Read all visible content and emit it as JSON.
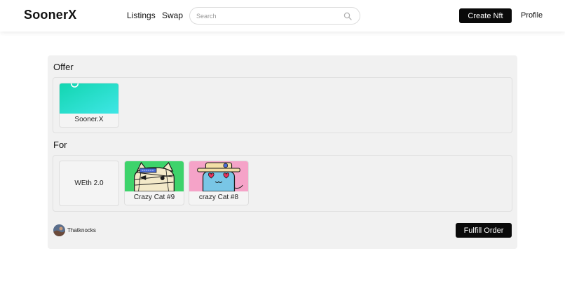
{
  "header": {
    "brand": "SoonerX",
    "nav": {
      "listings": "Listings",
      "swap": "Swap"
    },
    "search": {
      "placeholder": "Search",
      "value": ""
    },
    "create_label": "Create Nft",
    "profile_label": "Profile"
  },
  "order": {
    "offer_title": "Offer",
    "offer_items": [
      {
        "label": "Sooner.X",
        "image": "gradient-teal-cover"
      }
    ],
    "for_title": "For",
    "for_token": "WEth 2.0",
    "for_items": [
      {
        "label": "Crazy Cat #9",
        "image": "bandaged-cat-green"
      },
      {
        "label": "crazy Cat #8",
        "image": "heart-eyes-cat-pink"
      }
    ],
    "user": {
      "name": "Thatknocks",
      "avatar": "avatar-icon"
    },
    "fulfill_label": "Fulfill Order"
  },
  "colors": {
    "accent": "#0a0a0a",
    "card_bg": "#f1f1f1",
    "offer_gradient": [
      "#14d6b4",
      "#3be7e3"
    ],
    "cat9_bg": "#3ed36b",
    "cat8_bg": "#f5a3c8"
  }
}
